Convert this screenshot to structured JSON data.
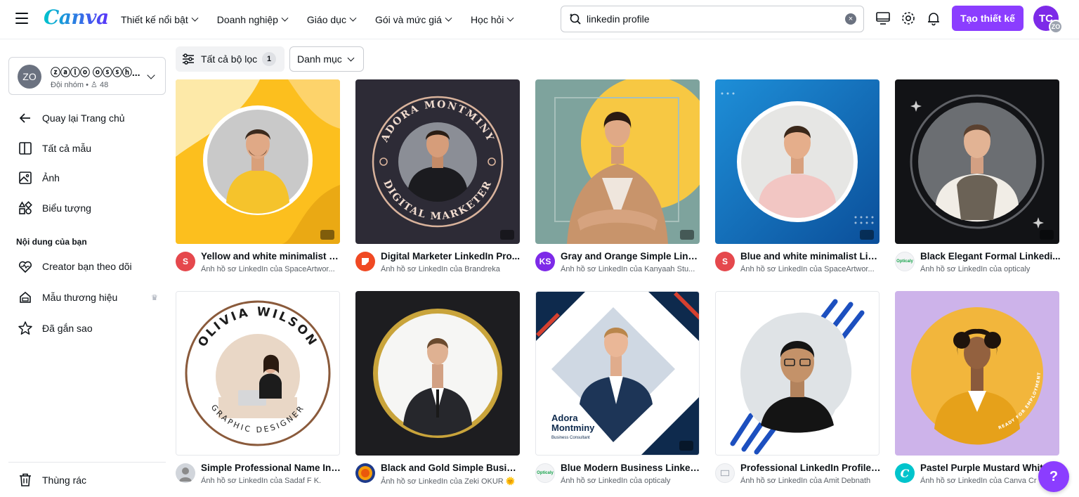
{
  "app": {
    "logo": "Canva"
  },
  "topnav": [
    {
      "label": "Thiết kế nổi bật"
    },
    {
      "label": "Doanh nghiệp"
    },
    {
      "label": "Giáo dục"
    },
    {
      "label": "Gói và mức giá"
    },
    {
      "label": "Học hỏi"
    }
  ],
  "search": {
    "value": "linkedin profile"
  },
  "toolbar": {
    "create_label": "Tạo thiết kế",
    "avatar_initials": "TC",
    "avatar_mini": "ZO"
  },
  "sidebar": {
    "team": {
      "avatar": "ZO",
      "name": "ⓩⓐⓛⓞ ⓞⓢⓢⓗ...",
      "sub": "Đội nhóm • ",
      "members": "48"
    },
    "items": [
      {
        "label": "Quay lại Trang chủ"
      },
      {
        "label": "Tất cả mẫu"
      },
      {
        "label": "Ảnh"
      },
      {
        "label": "Biểu tượng"
      }
    ],
    "section_title": "Nội dung của bạn",
    "content_items": [
      {
        "label": "Creator bạn theo dõi"
      },
      {
        "label": "Mẫu thương hiệu"
      },
      {
        "label": "Đã gắn sao"
      }
    ],
    "trash": "Thùng rác"
  },
  "filters": {
    "all_label": "Tất cả bộ lọc",
    "count": "1",
    "category_label": "Danh mục"
  },
  "templates": [
    {
      "title": "Yellow and white minimalist L...",
      "sub": "Ảnh hồ sơ LinkedIn của SpaceArtwor...",
      "avatar": "S",
      "avatar_color": "#e5484d"
    },
    {
      "title": "Digital Marketer LinkedIn Pro...",
      "sub": "Ảnh hồ sơ LinkedIn của Brandreka",
      "avatar": "",
      "avatar_color": "#f04923"
    },
    {
      "title": "Gray and Orange Simple Link...",
      "sub": "Ảnh hồ sơ LinkedIn của Kanyaah Stu...",
      "avatar": "KS",
      "avatar_color": "#7d2ae8"
    },
    {
      "title": "Blue and white minimalist Lin...",
      "sub": "Ảnh hồ sơ LinkedIn của SpaceArtwor...",
      "avatar": "S",
      "avatar_color": "#e5484d"
    },
    {
      "title": "Black Elegant Formal Linkedi...",
      "sub": "Ảnh hồ sơ LinkedIn của opticaly",
      "avatar": "Opticaly",
      "avatar_color": "#f3f4f6"
    },
    {
      "title": "Simple Professional Name Int...",
      "sub": "Ảnh hồ sơ LinkedIn của Sadaf F K.",
      "avatar": "",
      "avatar_color": "#d1d5db"
    },
    {
      "title": "Black and Gold Simple Busine...",
      "sub": "Ảnh hồ sơ LinkedIn của Zeki OKUR 🌞",
      "avatar": "",
      "avatar_color": "#1e3a8a"
    },
    {
      "title": "Blue Modern Business Linked...",
      "sub": "Ảnh hồ sơ LinkedIn của opticaly",
      "avatar": "Opticaly",
      "avatar_color": "#f3f4f6"
    },
    {
      "title": "Professional LinkedIn Profile ...",
      "sub": "Ảnh hồ sơ LinkedIn của Amit Debnath",
      "avatar": "",
      "avatar_color": "#f3f4f6"
    },
    {
      "title": "Pastel Purple Mustard White",
      "sub": "Ảnh hồ sơ LinkedIn của Canva Cr",
      "avatar": "C",
      "avatar_color": "#00c4cc"
    }
  ],
  "thumb_text": {
    "adora_arc_top": "ADORA MONTMINY",
    "adora_arc_bottom": "DIGITAL MARKETER",
    "olivia_top": "OLIVIA WILSON",
    "olivia_bottom": "GRAPHIC DESIGNER",
    "adora_name_1": "Adora",
    "adora_name_2": "Montminy",
    "adora_role": "Business Consultant",
    "ready": "READY FOR EMPLOYMENT"
  },
  "help_label": "?"
}
